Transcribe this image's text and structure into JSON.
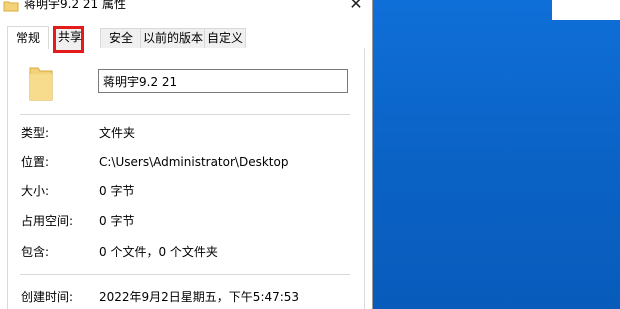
{
  "dialog": {
    "title": "蒋明宇9.2 21 属性",
    "close_symbol": "✕"
  },
  "tabs": [
    {
      "label": "常规",
      "active": true
    },
    {
      "label": "共享",
      "active": false,
      "highlighted": true
    },
    {
      "label": "安全",
      "active": false
    },
    {
      "label": "以前的版本",
      "active": false
    },
    {
      "label": "自定义",
      "active": false
    }
  ],
  "general": {
    "name_value": "蒋明宇9.2 21",
    "properties": {
      "type_label": "类型:",
      "type_value": "文件夹",
      "location_label": "位置:",
      "location_value": "C:\\Users\\Administrator\\Desktop",
      "size_label": "大小:",
      "size_value": "0 字节",
      "disk_label": "占用空间:",
      "disk_value": "0 字节",
      "contains_label": "包含:",
      "contains_value": "0 个文件，0 个文件夹",
      "created_label": "创建时间:",
      "created_value": "2022年9月2日星期五，下午5:47:53"
    }
  },
  "colors": {
    "highlight": "#e41b1b",
    "desktop": "#0b63c6",
    "folder": "#f3d27a"
  },
  "icons": {
    "title": "folder-icon",
    "large": "folder-icon",
    "close": "close-icon"
  }
}
